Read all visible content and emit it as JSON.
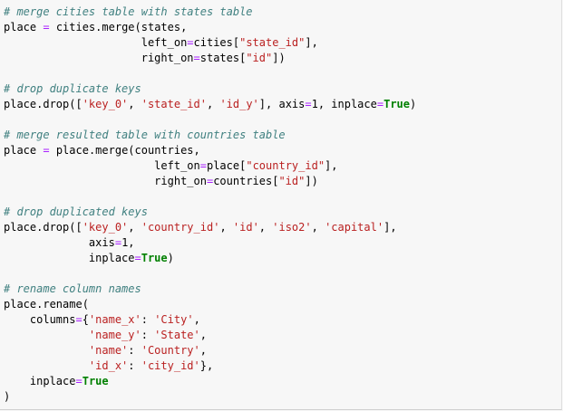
{
  "colors": {
    "background": "#f7f7f7",
    "comment": "#408080",
    "string": "#ba2121",
    "operator": "#aa22ff",
    "keyword": "#008000",
    "text": "#000000"
  },
  "lines": [
    [
      {
        "t": "c",
        "v": "# merge cities table with states table"
      }
    ],
    [
      {
        "t": "n",
        "v": "place "
      },
      {
        "t": "o",
        "v": "="
      },
      {
        "t": "n",
        "v": " cities.merge(states,"
      }
    ],
    [
      {
        "t": "n",
        "v": "                     left_on"
      },
      {
        "t": "o",
        "v": "="
      },
      {
        "t": "n",
        "v": "cities["
      },
      {
        "t": "s",
        "v": "\"state_id\""
      },
      {
        "t": "n",
        "v": "],"
      }
    ],
    [
      {
        "t": "n",
        "v": "                     right_on"
      },
      {
        "t": "o",
        "v": "="
      },
      {
        "t": "n",
        "v": "states["
      },
      {
        "t": "s",
        "v": "\"id\""
      },
      {
        "t": "n",
        "v": "])"
      }
    ],
    [],
    [
      {
        "t": "c",
        "v": "# drop duplicate keys"
      }
    ],
    [
      {
        "t": "n",
        "v": "place.drop(["
      },
      {
        "t": "s",
        "v": "'key_0'"
      },
      {
        "t": "n",
        "v": ", "
      },
      {
        "t": "s",
        "v": "'state_id'"
      },
      {
        "t": "n",
        "v": ", "
      },
      {
        "t": "s",
        "v": "'id_y'"
      },
      {
        "t": "n",
        "v": "], axis"
      },
      {
        "t": "o",
        "v": "="
      },
      {
        "t": "n",
        "v": "1, inplace"
      },
      {
        "t": "o",
        "v": "="
      },
      {
        "t": "k",
        "v": "True"
      },
      {
        "t": "n",
        "v": ")"
      }
    ],
    [],
    [
      {
        "t": "c",
        "v": "# merge resulted table with countries table"
      }
    ],
    [
      {
        "t": "n",
        "v": "place "
      },
      {
        "t": "o",
        "v": "="
      },
      {
        "t": "n",
        "v": " place.merge(countries,"
      }
    ],
    [
      {
        "t": "n",
        "v": "                       left_on"
      },
      {
        "t": "o",
        "v": "="
      },
      {
        "t": "n",
        "v": "place["
      },
      {
        "t": "s",
        "v": "\"country_id\""
      },
      {
        "t": "n",
        "v": "],"
      }
    ],
    [
      {
        "t": "n",
        "v": "                       right_on"
      },
      {
        "t": "o",
        "v": "="
      },
      {
        "t": "n",
        "v": "countries["
      },
      {
        "t": "s",
        "v": "\"id\""
      },
      {
        "t": "n",
        "v": "])"
      }
    ],
    [],
    [
      {
        "t": "c",
        "v": "# drop duplicated keys"
      }
    ],
    [
      {
        "t": "n",
        "v": "place.drop(["
      },
      {
        "t": "s",
        "v": "'key_0'"
      },
      {
        "t": "n",
        "v": ", "
      },
      {
        "t": "s",
        "v": "'country_id'"
      },
      {
        "t": "n",
        "v": ", "
      },
      {
        "t": "s",
        "v": "'id'"
      },
      {
        "t": "n",
        "v": ", "
      },
      {
        "t": "s",
        "v": "'iso2'"
      },
      {
        "t": "n",
        "v": ", "
      },
      {
        "t": "s",
        "v": "'capital'"
      },
      {
        "t": "n",
        "v": "],"
      }
    ],
    [
      {
        "t": "n",
        "v": "             axis"
      },
      {
        "t": "o",
        "v": "="
      },
      {
        "t": "n",
        "v": "1,"
      }
    ],
    [
      {
        "t": "n",
        "v": "             inplace"
      },
      {
        "t": "o",
        "v": "="
      },
      {
        "t": "k",
        "v": "True"
      },
      {
        "t": "n",
        "v": ")"
      }
    ],
    [],
    [
      {
        "t": "c",
        "v": "# rename column names"
      }
    ],
    [
      {
        "t": "n",
        "v": "place.rename("
      }
    ],
    [
      {
        "t": "n",
        "v": "    columns"
      },
      {
        "t": "o",
        "v": "="
      },
      {
        "t": "n",
        "v": "{"
      },
      {
        "t": "s",
        "v": "'name_x'"
      },
      {
        "t": "n",
        "v": ": "
      },
      {
        "t": "s",
        "v": "'City'"
      },
      {
        "t": "n",
        "v": ","
      }
    ],
    [
      {
        "t": "n",
        "v": "             "
      },
      {
        "t": "s",
        "v": "'name_y'"
      },
      {
        "t": "n",
        "v": ": "
      },
      {
        "t": "s",
        "v": "'State'"
      },
      {
        "t": "n",
        "v": ","
      }
    ],
    [
      {
        "t": "n",
        "v": "             "
      },
      {
        "t": "s",
        "v": "'name'"
      },
      {
        "t": "n",
        "v": ": "
      },
      {
        "t": "s",
        "v": "'Country'"
      },
      {
        "t": "n",
        "v": ","
      }
    ],
    [
      {
        "t": "n",
        "v": "             "
      },
      {
        "t": "s",
        "v": "'id_x'"
      },
      {
        "t": "n",
        "v": ": "
      },
      {
        "t": "s",
        "v": "'city_id'"
      },
      {
        "t": "n",
        "v": "},"
      }
    ],
    [
      {
        "t": "n",
        "v": "    inplace"
      },
      {
        "t": "o",
        "v": "="
      },
      {
        "t": "k",
        "v": "True"
      }
    ],
    [
      {
        "t": "n",
        "v": ")"
      }
    ]
  ]
}
